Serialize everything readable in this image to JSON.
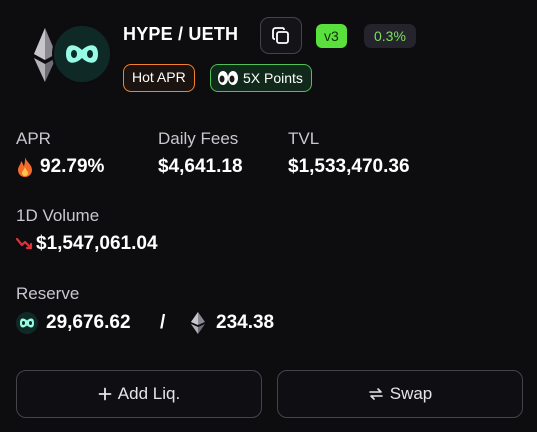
{
  "pair": {
    "title": "HYPE / UETH",
    "version": "v3",
    "fee_tier": "0.3%",
    "badges": {
      "hot_apr": "Hot APR",
      "points": "5X Points"
    }
  },
  "stats": {
    "apr": {
      "label": "APR",
      "value": "92.79%",
      "icon": "fire-icon"
    },
    "daily_fees": {
      "label": "Daily Fees",
      "value": "$4,641.18"
    },
    "tvl": {
      "label": "TVL",
      "value": "$1,533,470.36"
    },
    "volume_1d": {
      "label": "1D Volume",
      "value": "$1,547,061.04",
      "icon": "trend-down-icon"
    }
  },
  "reserve": {
    "label": "Reserve",
    "hype_amount": "29,676.62",
    "separator": "/",
    "ueth_amount": "234.38"
  },
  "actions": {
    "add_liquidity": {
      "icon": "plus-icon",
      "label": "Add Liq."
    },
    "swap": {
      "icon": "swap-arrows-icon",
      "label": "Swap"
    }
  },
  "colors": {
    "background": "#0d0c0f",
    "hype_mint": "#97fce4",
    "version_green": "#59e03c",
    "hot_orange": "#f3812c",
    "points_green": "#4fbf57",
    "trend_red": "#e0303a"
  }
}
